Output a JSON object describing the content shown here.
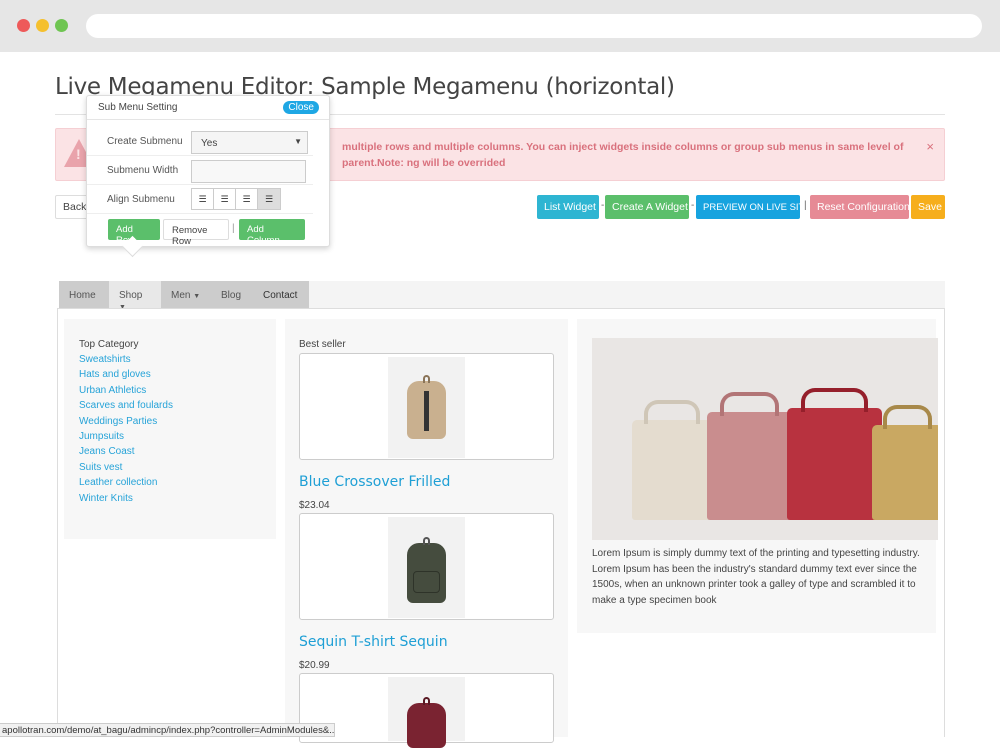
{
  "page": {
    "title": "Live Megamenu Editor: Sample Megamenu (horizontal)"
  },
  "alert": {
    "text": "multiple rows and multiple columns. You can inject widgets inside columns or group sub menus in same level of parent.Note: ng will be overrided",
    "close": "×"
  },
  "toolbar": {
    "back": "Back",
    "list_widget": "List Widget",
    "create_widget": "Create A Widget",
    "preview": "PREVIEW ON LIVE SITE",
    "reset": "Reset Configuration",
    "save": "Save",
    "sep1": "-",
    "sep2": "-",
    "sep3": "|"
  },
  "popup": {
    "title": "Sub Menu Setting",
    "close": "Close",
    "create_label": "Create Submenu",
    "create_value": "Yes",
    "width_label": "Submenu Width",
    "align_label": "Align Submenu",
    "add_row": "Add Row",
    "remove_row": "Remove Row",
    "add_column": "Add Column",
    "sep": "|"
  },
  "menu": {
    "home": "Home",
    "shop": "Shop",
    "men": "Men",
    "blog": "Blog",
    "contact": "Contact"
  },
  "category": {
    "title": "Top Category",
    "items": [
      "Sweatshirts",
      "Hats and gloves",
      "Urban Athletics",
      "Scarves and foulards",
      "Weddings Parties",
      "Jumpsuits",
      "Jeans Coast",
      "Suits vest",
      "Leather collection",
      "Winter Knits"
    ]
  },
  "bestseller": {
    "title": "Best seller",
    "products": [
      {
        "name": "Blue Crossover Frilled",
        "price": "$23.04"
      },
      {
        "name": "Sequin T-shirt Sequin",
        "price": "$20.99"
      }
    ]
  },
  "feature": {
    "description": "Lorem Ipsum is simply dummy text of the printing and typesetting industry. Lorem Ipsum has been the industry's standard dummy text ever since the 1500s, when an unknown printer took a galley of type and scrambled it to make a type specimen book"
  },
  "status": {
    "url": "apollotran.com/demo/at_bagu/admincp/index.php?controller=AdminModules&..."
  },
  "colors": {
    "accent": "#1ea7e4",
    "success": "#5bbf6b",
    "danger_bg": "#fbe3e5",
    "warning": "#f6ae1c"
  }
}
